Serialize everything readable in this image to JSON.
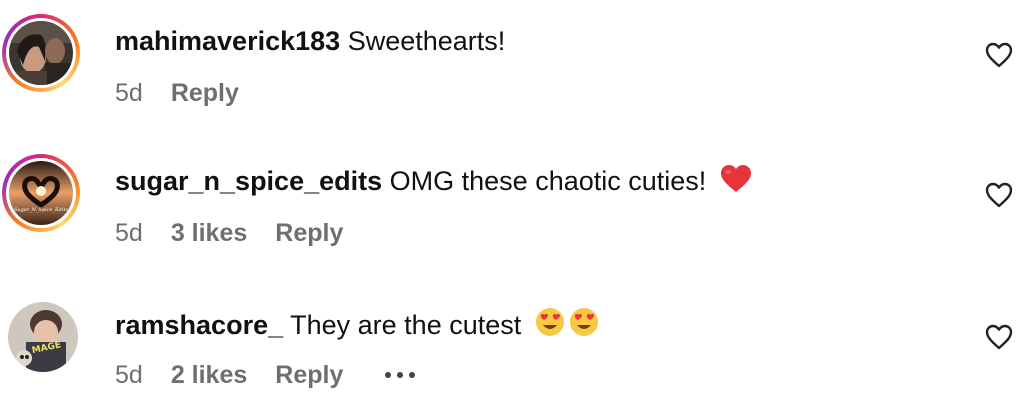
{
  "comments": [
    {
      "username": "mahimaverick183",
      "text": "Sweethearts!",
      "time": "5d",
      "likes": "",
      "reply_label": "Reply",
      "has_story_ring": true,
      "avatar_icon": "woman-portrait-avatar"
    },
    {
      "username": "sugar_n_spice_edits",
      "text": "OMG these chaotic cuties!",
      "emoji": "red-heart-emoji",
      "time": "5d",
      "likes": "3 likes",
      "reply_label": "Reply",
      "has_story_ring": true,
      "avatar_icon": "heart-hands-sunset-avatar",
      "avatar_caption": "Sugar_N_Spice_Edits"
    },
    {
      "username": "ramshacore_",
      "text": "They are the cutest",
      "emoji": "heart-eyes-emoji x2",
      "time": "5d",
      "likes": "2 likes",
      "reply_label": "Reply",
      "has_story_ring": false,
      "avatar_icon": "illustrated-character-avatar"
    }
  ],
  "colors": {
    "text_primary": "#111111",
    "text_secondary": "#6f6f6f",
    "ring_gradient": [
      "#d62976",
      "#fa7e1e",
      "#feda75",
      "#962fbf"
    ],
    "heart_emoji": "#e8323c"
  },
  "icons": {
    "like": "heart-outline-icon",
    "more": "more-options-icon"
  }
}
